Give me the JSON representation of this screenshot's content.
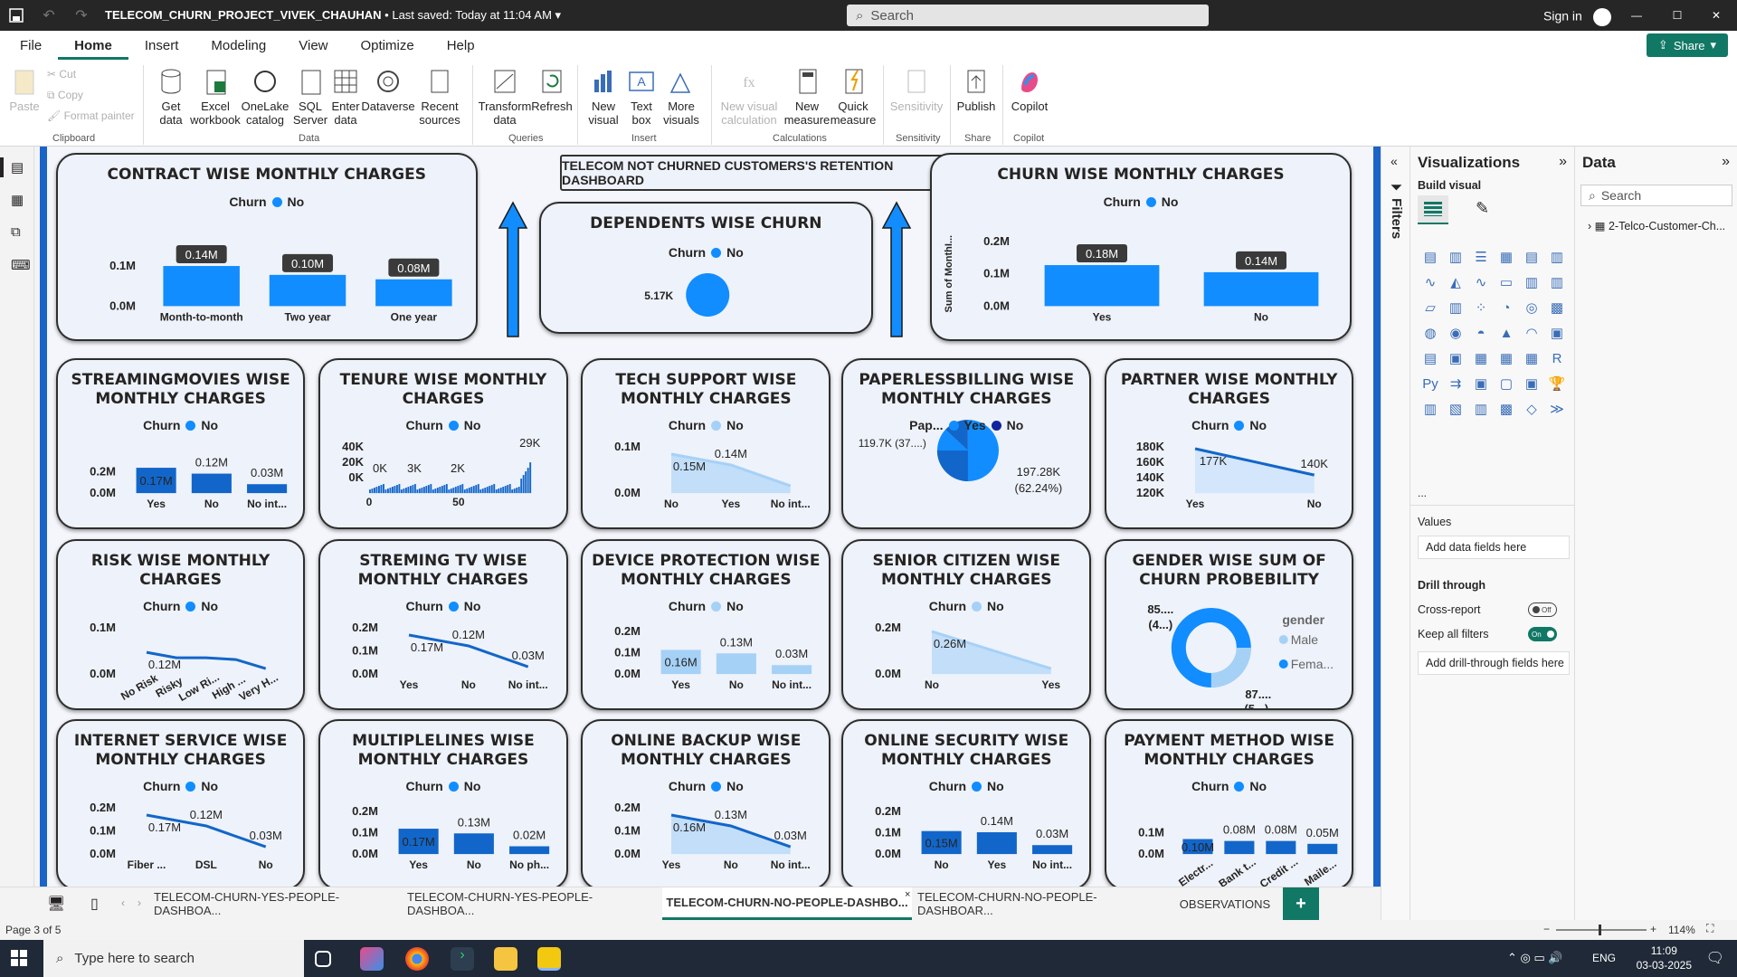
{
  "app": {
    "file_title": "TELECOM_CHURN_PROJECT_VIVEK_CHAUHAN",
    "saved": "• Last saved: Today at 11:04 AM",
    "search_placeholder": "Search",
    "sign_in": "Sign in",
    "share": "Share"
  },
  "menu": [
    "File",
    "Home",
    "Insert",
    "Modeling",
    "View",
    "Optimize",
    "Help"
  ],
  "ribbon": {
    "paste": "Paste",
    "cut": "Cut",
    "copy": "Copy",
    "format_painter": "Format painter",
    "clipboard": "Clipboard",
    "get_data": "Get data",
    "excel": "Excel workbook",
    "onelake": "OneLake catalog",
    "sql": "SQL Server",
    "enter": "Enter data",
    "dataverse": "Dataverse",
    "recent": "Recent sources",
    "data_grp": "Data",
    "transform": "Transform data",
    "refresh": "Refresh",
    "queries": "Queries",
    "new_visual": "New visual",
    "text_box": "Text box",
    "more_visuals": "More visuals",
    "insert": "Insert",
    "new_visual_calc": "New visual calculation",
    "new_measure": "New measure",
    "quick_measure": "Quick measure",
    "calculations": "Calculations",
    "sensitivity_btn": "Sensitivity",
    "sensitivity": "Sensitivity",
    "publish": "Publish",
    "share_grp": "Share",
    "copilot": "Copilot",
    "copilot_grp": "Copilot"
  },
  "dashboard": {
    "title": "TELECOM NOT CHURNED CUSTOMERS'S RETENTION DASHBOARD",
    "legend_churn": "Churn",
    "legend_no": "No",
    "legend_yes": "Yes"
  },
  "cards": [
    {
      "id": "contract",
      "title": "CONTRACT WISE MONTHLY CHARGES",
      "type": "bar",
      "ticks": [
        "0.1M",
        "0.0M"
      ],
      "cats": [
        "Month-to-month",
        "Two year",
        "One year"
      ],
      "labels": [
        "0.14M",
        "0.10M",
        "0.08M"
      ],
      "values": [
        0.14,
        0.1,
        0.08
      ]
    },
    {
      "id": "dependents",
      "title": "DEPENDENTS WISE CHURN",
      "type": "bubble",
      "label": "5.17K"
    },
    {
      "id": "churn",
      "title": "CHURN WISE MONTHLY CHARGES",
      "type": "bar",
      "ticks": [
        "0.2M",
        "0.1M",
        "0.0M"
      ],
      "ylabel": "Sum of MonthI...",
      "cats": [
        "Yes",
        "No"
      ],
      "labels": [
        "0.18M",
        "0.14M"
      ],
      "values": [
        0.18,
        0.14
      ]
    },
    {
      "id": "streaming_movies",
      "title": "STREAMINGMOVIES WISE MONTHLY CHARGES",
      "type": "bar",
      "ticks": [
        "0.2M",
        "0.0M"
      ],
      "cats": [
        "Yes",
        "No",
        "No int..."
      ],
      "labels": [
        "0.17M",
        "0.12M",
        "0.03M"
      ],
      "values": [
        0.17,
        0.12,
        0.03
      ]
    },
    {
      "id": "tenure",
      "title": "TENURE WISE MONTHLY CHARGES",
      "type": "tenure",
      "ticks": [
        "40K",
        "20K",
        "0K"
      ],
      "cats": [
        "0",
        "50"
      ],
      "labels": [
        "0K",
        "3K",
        "2K",
        "29K"
      ]
    },
    {
      "id": "tech_support",
      "title": "TECH SUPPORT WISE MONTHLY CHARGES",
      "type": "area",
      "ticks": [
        "0.1M",
        "0.0M"
      ],
      "cats": [
        "No",
        "Yes",
        "No int..."
      ],
      "labels": [
        "0.15M",
        "0.14M",
        ""
      ],
      "values": [
        0.15,
        0.14,
        0.03
      ]
    },
    {
      "id": "paperless",
      "title": "PAPERLESSBILLING WISE MONTHLY CHARGES",
      "type": "pie",
      "legend_field": "Pap...",
      "left_label": "119.7K (37....)",
      "right_label": "197.28K",
      "right_pct": "(62.24%)"
    },
    {
      "id": "partner",
      "title": "PARTNER WISE MONTHLY CHARGES",
      "type": "line",
      "ticks": [
        "180K",
        "160K",
        "140K",
        "120K"
      ],
      "cats": [
        "Yes",
        "No"
      ],
      "labels": [
        "177K",
        "140K"
      ],
      "values": [
        177,
        140
      ]
    },
    {
      "id": "risk",
      "title": "RISK WISE MONTHLY CHARGES",
      "type": "line5",
      "ticks": [
        "0.1M",
        "0.0M"
      ],
      "cats": [
        "No Risk",
        "Risky",
        "Low Ri...",
        "High ...",
        "Very H..."
      ],
      "labels": [
        "0.12M"
      ]
    },
    {
      "id": "streaming_tv",
      "title": "STREMING TV WISE MONTHLY CHARGES",
      "type": "line3",
      "ticks": [
        "0.2M",
        "0.1M",
        "0.0M"
      ],
      "cats": [
        "Yes",
        "No",
        "No int..."
      ],
      "labels": [
        "0.17M",
        "0.12M",
        "0.03M"
      ]
    },
    {
      "id": "device_protection",
      "title": "DEVICE PROTECTION WISE MONTHLY CHARGES",
      "type": "bar_light",
      "ticks": [
        "0.2M",
        "0.1M",
        "0.0M"
      ],
      "cats": [
        "Yes",
        "No",
        "No int..."
      ],
      "labels": [
        "0.16M",
        "0.13M",
        "0.03M"
      ],
      "values": [
        0.16,
        0.13,
        0.03
      ]
    },
    {
      "id": "senior",
      "title": "SENIOR CITIZEN WISE MONTHLY CHARGES",
      "type": "area2",
      "ticks": [
        "0.2M",
        "0.0M"
      ],
      "cats": [
        "No",
        "Yes"
      ],
      "labels": [
        "0.26M"
      ]
    },
    {
      "id": "gender",
      "title": "GENDER WISE SUM OF CHURN PROBEBILITY",
      "type": "donut",
      "legend_title": "gender",
      "legend": [
        "Male",
        "Fema..."
      ],
      "label_top": "85....",
      "label_top2": "(4...)",
      "label_bot": "87....",
      "label_bot2": "(5...)"
    },
    {
      "id": "internet",
      "title": "INTERNET SERVICE WISE MONTHLY CHARGES",
      "type": "line3",
      "ticks": [
        "0.2M",
        "0.1M",
        "0.0M"
      ],
      "cats": [
        "Fiber ...",
        "DSL",
        "No"
      ],
      "labels": [
        "0.17M",
        "0.12M",
        "0.03M"
      ]
    },
    {
      "id": "multiplelines",
      "title": "MULTIPLELINES WISE MONTHLY CHARGES",
      "type": "bar",
      "ticks": [
        "0.2M",
        "0.1M",
        "0.0M"
      ],
      "cats": [
        "Yes",
        "No",
        "No ph..."
      ],
      "labels": [
        "0.17M",
        "0.13M",
        "0.02M"
      ],
      "values": [
        0.17,
        0.13,
        0.02
      ]
    },
    {
      "id": "online_backup",
      "title": "ONLINE BACKUP WISE MONTHLY CHARGES",
      "type": "area3",
      "ticks": [
        "0.2M",
        "0.1M",
        "0.0M"
      ],
      "cats": [
        "Yes",
        "No",
        "No int..."
      ],
      "labels": [
        "0.16M",
        "0.13M",
        "0.03M"
      ]
    },
    {
      "id": "online_security",
      "title": "ONLINE SECURITY WISE MONTHLY CHARGES",
      "type": "bar",
      "ticks": [
        "0.2M",
        "0.1M",
        "0.0M"
      ],
      "cats": [
        "No",
        "Yes",
        "No int..."
      ],
      "labels": [
        "0.15M",
        "0.14M",
        "0.03M"
      ],
      "values": [
        0.15,
        0.14,
        0.03
      ]
    },
    {
      "id": "payment",
      "title": "PAYMENT METHOD WISE MONTHLY CHARGES",
      "type": "bar4",
      "ticks": [
        "0.1M",
        "0.0M"
      ],
      "cats": [
        "Electr...",
        "Bank t...",
        "Credit ...",
        "Maile..."
      ],
      "labels": [
        "0.10M",
        "0.08M",
        "0.08M",
        "0.05M"
      ],
      "values": [
        0.1,
        0.08,
        0.08,
        0.05
      ]
    }
  ],
  "filters": "Filters",
  "viz": {
    "title": "Visualizations",
    "build": "Build visual",
    "values": "Values",
    "add_fields": "Add data fields here",
    "drill": "Drill through",
    "cross": "Cross-report",
    "cross_state": "Off",
    "keep": "Keep all filters",
    "keep_state": "On",
    "add_drill": "Add drill-through fields here",
    "more": "..."
  },
  "data_pane": {
    "title": "Data",
    "search": "Search",
    "table": "2-Telco-Customer-Ch..."
  },
  "tabs": [
    "TELECOM-CHURN-YES-PEOPLE-DASHBOA...",
    "TELECOM-CHURN-YES-PEOPLE-DASHBOA...",
    "TELECOM-CHURN-NO-PEOPLE-DASHBO...",
    "TELECOM-CHURN-NO-PEOPLE-DASHBOAR...",
    "OBSERVATIONS"
  ],
  "status": {
    "page": "Page 3 of 5",
    "zoom": "114%"
  },
  "taskbar": {
    "search": "Type here to search",
    "time": "11:09",
    "date": "03-03-2025",
    "lang": "ENG"
  }
}
